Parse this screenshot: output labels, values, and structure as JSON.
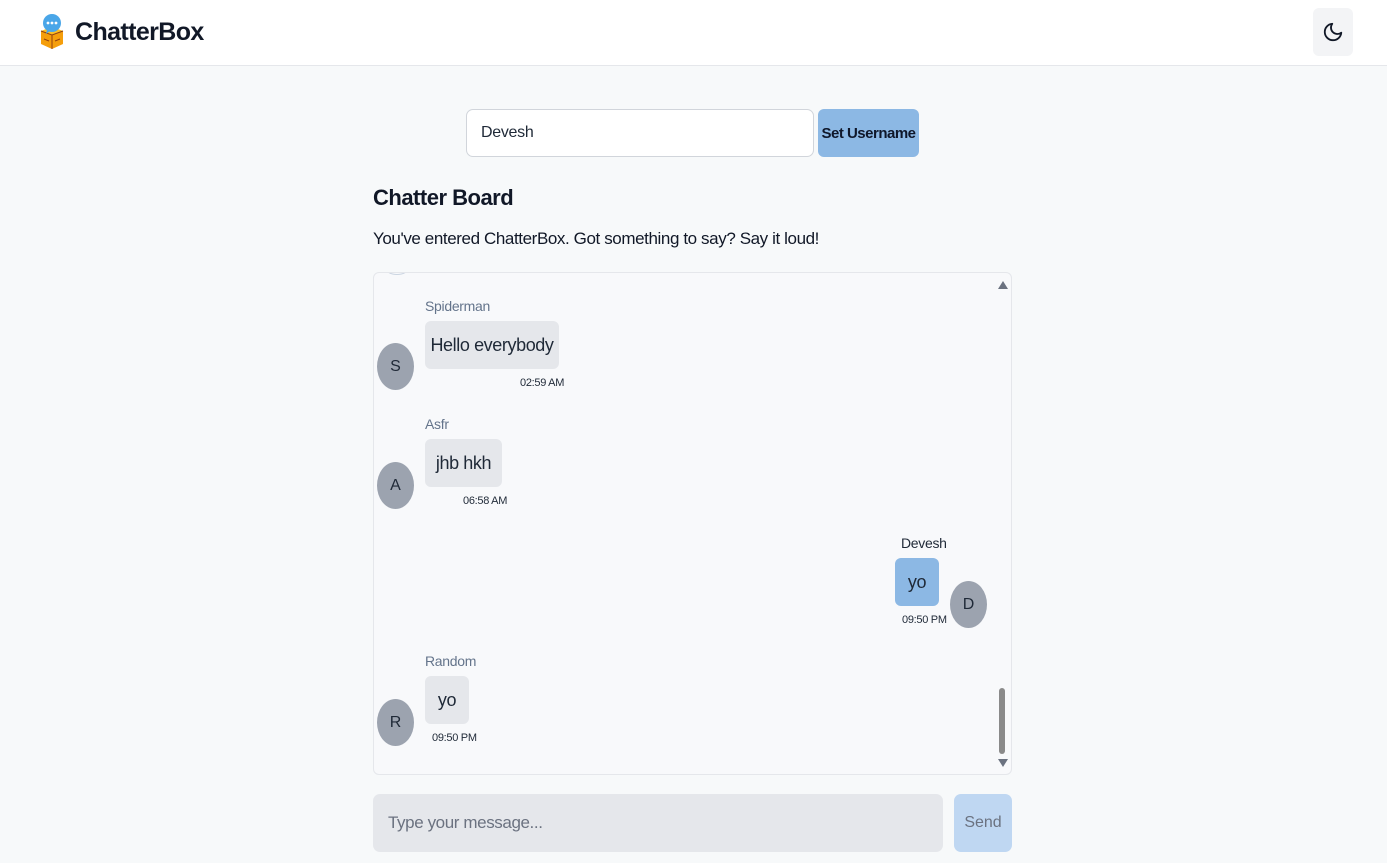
{
  "app": {
    "name": "ChatterBox"
  },
  "colors": {
    "accent": "#8cb8e4",
    "avatar": "#9ca3af",
    "bubble": "#e5e7eb"
  },
  "icons": {
    "logo": "chat-box-logo-icon",
    "theme_toggle": "moon-icon"
  },
  "username": {
    "value": "Devesh",
    "button_label": "Set Username"
  },
  "board": {
    "title": "Chatter Board",
    "subtitle": "You've entered ChatterBox. Got something to say? Say it loud!"
  },
  "messages": [
    {
      "initial": "S",
      "sender": "Spiderman",
      "text": "Hello everybody",
      "time": "02:59 AM",
      "own": false
    },
    {
      "initial": "A",
      "sender": "Asfr",
      "text": "jhb hkh",
      "time": "06:58 AM",
      "own": false
    },
    {
      "initial": "D",
      "sender": "Devesh",
      "text": "yo",
      "time": "09:50 PM",
      "own": true
    },
    {
      "initial": "R",
      "sender": "Random",
      "text": "yo",
      "time": "09:50 PM",
      "own": false
    }
  ],
  "composer": {
    "placeholder": "Type your message...",
    "send_label": "Send"
  }
}
